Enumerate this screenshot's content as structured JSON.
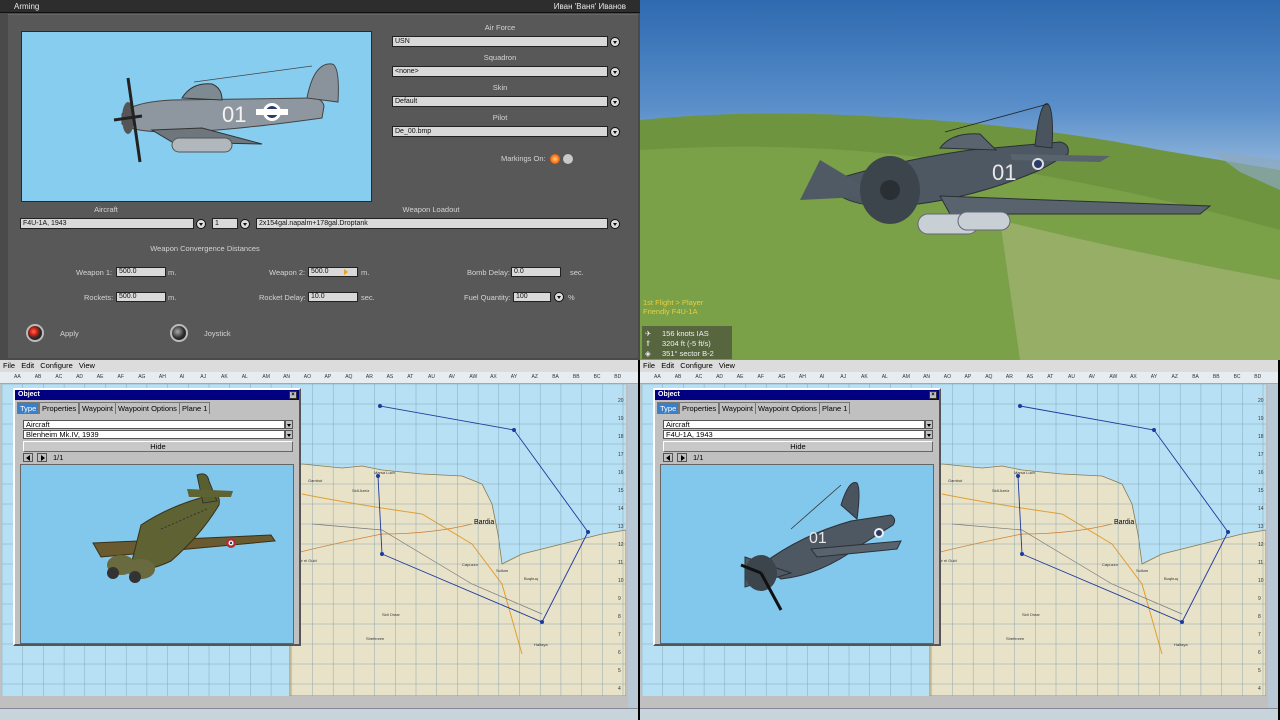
{
  "arming": {
    "title": "Arming",
    "user": "Иван 'Ваня' Иванов",
    "labels": {
      "air_force": "Air Force",
      "squadron": "Squadron",
      "skin": "Skin",
      "pilot": "Pilot",
      "markings": "Markings On:",
      "aircraft": "Aircraft",
      "weapon_loadout": "Weapon Loadout",
      "convergence": "Weapon Convergence Distances",
      "weapon1": "Weapon 1:",
      "weapon2": "Weapon 2:",
      "bomb_delay": "Bomb Delay:",
      "rockets": "Rockets:",
      "rocket_delay": "Rocket Delay:",
      "fuel_quantity": "Fuel Quantity:",
      "unit_m": "m.",
      "unit_sec": "sec.",
      "unit_pct": "%",
      "apply": "Apply",
      "joystick": "Joystick"
    },
    "values": {
      "air_force": "USN",
      "squadron": "<none>",
      "skin": "Default",
      "pilot": "De_00.bmp",
      "aircraft": "F4U-1A, 1943",
      "count": "1",
      "weapon_loadout": "2x154gal.napalm+178gal.Droptank",
      "weapon1": "500.0",
      "weapon2": "500.0",
      "bomb_delay": "0.0",
      "rockets": "500.0",
      "rocket_delay": "10.0",
      "fuel_quantity": "100"
    },
    "plane_code": "01"
  },
  "view3d": {
    "flight_line1": "1st Flight > Player",
    "flight_line2": "Friendly F4U-1A",
    "speed": "156 knots IAS",
    "altitude": "3204 ft (-5 ft/s)",
    "heading": "351° sector B-2",
    "plane_code": "01"
  },
  "fmb": {
    "menu": [
      "File",
      "Edit",
      "Configure",
      "View"
    ],
    "columns": [
      "AA",
      "AB",
      "AC",
      "AD",
      "AE",
      "AF",
      "AG",
      "AH",
      "AI",
      "AJ",
      "AK",
      "AL",
      "AM",
      "AN",
      "AO",
      "AP",
      "AQ",
      "AR",
      "AS",
      "AT",
      "AU",
      "AV",
      "AW",
      "AX",
      "AY",
      "AZ",
      "BA",
      "BB",
      "BC",
      "BD"
    ],
    "rows": [
      "20",
      "19",
      "18",
      "17",
      "16",
      "15",
      "14",
      "13",
      "12",
      "11",
      "10",
      "9",
      "8",
      "7",
      "6",
      "5",
      "4"
    ],
    "places": {
      "bardia": "Bardia",
      "marsa": "Marsa Luch",
      "sidi_azeiz": "Sidi Azeiz",
      "capuzzo": "Capuzzo",
      "sollum": "Sollum",
      "buqbuq": "Buqbuq",
      "sidi_omar": "Sidi Omar",
      "sheferzen": "Sheferzen",
      "gambut": "Gambut",
      "bir_el_gubi": "Bir el Gubi",
      "halfaya": "Halfaya"
    },
    "left": {
      "window_title": "Object",
      "tabs": [
        "Type",
        "Properties",
        "Waypoint",
        "Waypoint Options",
        "Plane 1"
      ],
      "category": "Aircraft",
      "aircraft": "Blenheim Mk.IV, 1939",
      "hide": "Hide",
      "page": "1/1"
    },
    "right": {
      "window_title": "Object",
      "tabs": [
        "Type",
        "Properties",
        "Waypoint",
        "Waypoint Options",
        "Plane 1"
      ],
      "category": "Aircraft",
      "aircraft": "F4U-1A, 1943",
      "hide": "Hide",
      "page": "1/1",
      "plane_code": "01"
    }
  },
  "colors": {
    "panel_bg": "#585858",
    "preview_sky": "#87cdf0",
    "map_sea": "#b8e0f4",
    "map_land": "#e8e2c8",
    "route": "#1e3a9c",
    "hud_yellow": "#e8d040",
    "titlebar_blue": "#000080"
  }
}
